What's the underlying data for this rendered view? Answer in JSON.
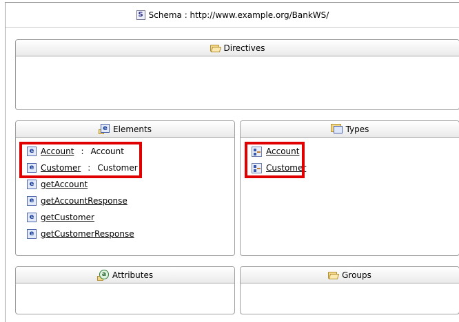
{
  "schema": {
    "icon": "schema-s-icon",
    "icon_letter": "S",
    "title": "Schema : http://www.example.org/BankWS/"
  },
  "panels": {
    "directives": {
      "title": "Directives",
      "icon": "folder-open-icon"
    },
    "elements": {
      "title": "Elements",
      "icon": "element-folder-icon",
      "icon_letter": "e",
      "items": [
        {
          "name": "Account",
          "separator": ":",
          "type": "Account"
        },
        {
          "name": "Customer",
          "separator": ":",
          "type": "Customer"
        },
        {
          "name": "getAccount"
        },
        {
          "name": "getAccountResponse"
        },
        {
          "name": "getCustomer"
        },
        {
          "name": "getCustomerResponse"
        }
      ]
    },
    "types": {
      "title": "Types",
      "icon": "types-folder-icon",
      "items": [
        {
          "name": "Account"
        },
        {
          "name": "Customer"
        }
      ]
    },
    "attributes": {
      "title": "Attributes",
      "icon": "attribute-folder-icon",
      "icon_letter": "a"
    },
    "groups": {
      "title": "Groups",
      "icon": "groups-folder-icon"
    }
  },
  "colors": {
    "highlight": "#e00000",
    "panel_border": "#9e9e9e",
    "header_gradient_bottom": "#eaeaea"
  }
}
